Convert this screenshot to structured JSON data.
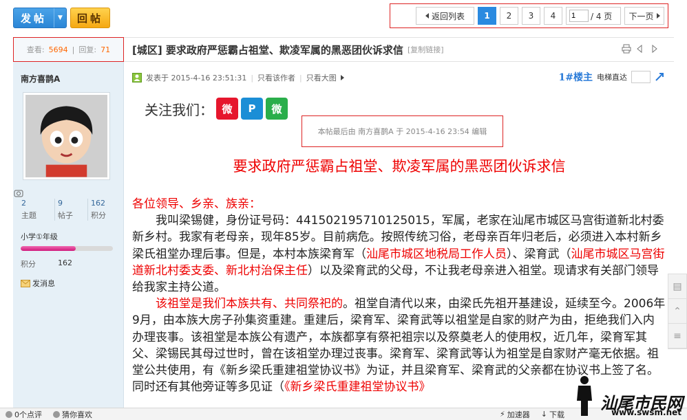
{
  "toolbar": {
    "post_label": "发帖",
    "reply_label": "回帖"
  },
  "pager": {
    "back_label": "返回列表",
    "pages": [
      "1",
      "2",
      "3",
      "4"
    ],
    "current": "1",
    "jump_value": "1",
    "total_label": "/ 4 页",
    "next_label": "下一页"
  },
  "stats": {
    "view_label": "查看:",
    "views": "5694",
    "sep": "|",
    "reply_label": "回复:",
    "replies": "71"
  },
  "thread": {
    "title": "[城区] 要求政府严惩霸占祖堂、欺凌军属的黑恶团伙诉求信",
    "copy_link": "[复制链接]"
  },
  "author": {
    "name": "南方喜鹊A",
    "stats": [
      {
        "num": "2",
        "label": "主题"
      },
      {
        "num": "9",
        "label": "帖子"
      },
      {
        "num": "162",
        "label": "积分"
      }
    ],
    "grade": "小学①年级",
    "progress": 0.6,
    "points_label": "积分",
    "points": "162",
    "message": "发消息"
  },
  "post": {
    "meta_date": "发表于 2015-4-16 23:51:31",
    "only_author": "只看该作者",
    "big_image": "只看大图",
    "floor": "1#楼主",
    "lift": "电梯直达",
    "follow": "关注我们：",
    "edit_note": "本帖最后由 南方喜鹊A 于 2015-4-16 23:54 编辑",
    "headline": "要求政府严惩霸占祖堂、欺凌军属的黑恶团伙诉求信",
    "greeting": "各位领导、乡亲、族亲：",
    "p1a": "我叫梁锡健，身份证号码：441502195710125015，军属，老家在汕尾市城区马宫街道新北村委新乡村。我家有老母亲，现年85岁。目前病危。按照传统习俗，老母亲百年归老后，必须进入本村新乡梁氏祖堂办理后事。但是，本村本族梁育军（",
    "p1r1": "汕尾市城区地税局工作人员",
    "p1b": "）、梁育武（",
    "p1r2": "汕尾市城区马宫街道新北村委支委、新北村治保主任",
    "p1c": "）以及梁育武的父母，不让我老母亲进入祖堂。现请求有关部门领导给我家主持公道。",
    "p2r": "该祖堂是我们本族共有、共同祭祀的",
    "p2": "。祖堂自清代以来，由梁氏先祖开基建设，延续至今。2006年9月，由本族大房子孙集资重建。重建后，梁育军、梁育武等以祖堂是自家的财产为由，拒绝我们入内办理丧事。该祖堂是本族公有遗产，本族都享有祭祀祖宗以及祭奠老人的使用权，近几年，梁育军其父、梁锡民其母过世时，曾在该祖堂办理过丧事。梁育军、梁育武等认为祖堂是自家财产毫无依据。祖堂公共使用，有《新乡梁氏重建祖堂协议书》为证，并且梁育军、梁育武的父亲都在协议书上签了名。同时还有其他旁证等多见证（",
    "p2r2": "《新乡梁氏重建祖堂协议书》"
  },
  "statusbar": {
    "comments": "0个点评",
    "guess": "猜你喜欢",
    "accelerator": "加速器",
    "download": "下载"
  },
  "watermark": {
    "brand": "汕尾市民网",
    "url": "www.swsm.net"
  }
}
